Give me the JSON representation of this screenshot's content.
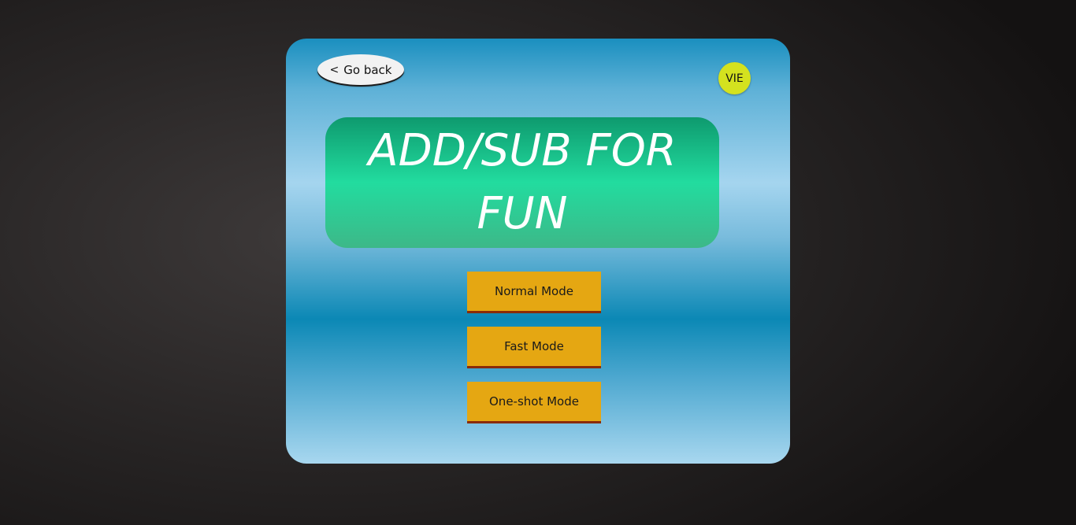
{
  "header": {
    "back_label": "Go back",
    "back_icon": "chevron-left-icon",
    "back_chevron": "<",
    "language_label": "VIE"
  },
  "title": {
    "text": "ADD/SUB FOR FUN"
  },
  "modes": [
    {
      "label": "Normal Mode"
    },
    {
      "label": "Fast Mode"
    },
    {
      "label": "One-shot Mode"
    }
  ],
  "colors": {
    "title_box": "#22dc9f",
    "mode_button": "#e5a712",
    "mode_button_border": "#8a2b06",
    "language_button": "#d4e21f",
    "back_button": "#f2f2f2"
  }
}
